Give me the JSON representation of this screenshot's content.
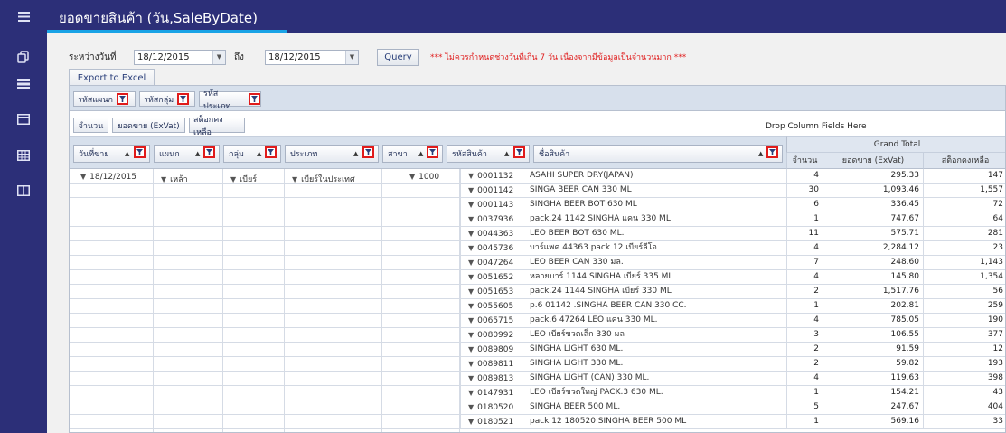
{
  "header": {
    "title": "ยอดขายสินค้า (วัน,SaleByDate)"
  },
  "sidebar": {
    "items": [
      {
        "icon": "hamburger-menu-icon"
      },
      {
        "icon": "copy-icon"
      },
      {
        "icon": "stack-icon"
      },
      {
        "icon": "card-icon"
      },
      {
        "icon": "grid-icon"
      },
      {
        "icon": "columns-icon"
      }
    ]
  },
  "filters": {
    "from_label": "ระหว่างวันที่",
    "from_value": "18/12/2015",
    "to_label": "ถึง",
    "to_value": "18/12/2015",
    "query_label": "Query",
    "warning": "*** ไม่ควรกำหนดช่วงวันที่เกิน 7 วัน เนื่องจากมีข้อมูลเป็นจำนวนมาก ***"
  },
  "export_label": "Export to Excel",
  "pivot": {
    "filter_fields": [
      "รหัสแผนก",
      "รหัสกลุ่ม",
      "รหัสประเภท"
    ],
    "data_fields": [
      "จำนวน",
      "ยอดขาย (ExVat)",
      "สต็อกคงเหลือ"
    ],
    "drop_column_text": "Drop Column Fields Here",
    "row_fields": [
      "วันที่ขาย",
      "แผนก",
      "กลุ่ม",
      "ประเภท",
      "สาขา",
      "รหัสสินค้า",
      "ชื่อสินค้า"
    ],
    "grand_total": "Grand Total",
    "measures": [
      "จำนวน",
      "ยอดขาย (ExVat)",
      "สต็อกคงเหลือ"
    ],
    "dims": {
      "date": "18/12/2015",
      "department": "เหล้า",
      "group": "เบียร์",
      "type": "เบียร์ในประเทศ",
      "branch": "1000"
    },
    "rows": [
      {
        "code": "0001132",
        "name": "ASAHI SUPER DRY(JAPAN)",
        "qty": "4",
        "sales": "295.33",
        "stock": "147"
      },
      {
        "code": "0001142",
        "name": "SINGA BEER CAN 330 ML",
        "qty": "30",
        "sales": "1,093.46",
        "stock": "1,557"
      },
      {
        "code": "0001143",
        "name": "SINGHA BEER BOT 630 ML",
        "qty": "6",
        "sales": "336.45",
        "stock": "72"
      },
      {
        "code": "0037936",
        "name": "pack.24 1142 SINGHA แคน 330 ML",
        "qty": "1",
        "sales": "747.67",
        "stock": "64"
      },
      {
        "code": "0044363",
        "name": "LEO BEER BOT 630 ML.",
        "qty": "11",
        "sales": "575.71",
        "stock": "281"
      },
      {
        "code": "0045736",
        "name": "บาร์แพค 44363 pack 12 เบียร์ลีโอ",
        "qty": "4",
        "sales": "2,284.12",
        "stock": "23"
      },
      {
        "code": "0047264",
        "name": "LEO BEER CAN 330 มล.",
        "qty": "7",
        "sales": "248.60",
        "stock": "1,143"
      },
      {
        "code": "0051652",
        "name": "หลายบาร์ 1144 SINGHA เบียร์ 335 ML",
        "qty": "4",
        "sales": "145.80",
        "stock": "1,354"
      },
      {
        "code": "0051653",
        "name": "pack.24 1144 SINGHA เบียร์ 330 ML",
        "qty": "2",
        "sales": "1,517.76",
        "stock": "56"
      },
      {
        "code": "0055605",
        "name": "p.6 01142 .SINGHA BEER CAN 330 CC.",
        "qty": "1",
        "sales": "202.81",
        "stock": "259"
      },
      {
        "code": "0065715",
        "name": "pack.6 47264 LEO แคน 330 ML.",
        "qty": "4",
        "sales": "785.05",
        "stock": "190"
      },
      {
        "code": "0080992",
        "name": "LEO เบียร์ขวดเล็ก 330 มล",
        "qty": "3",
        "sales": "106.55",
        "stock": "377"
      },
      {
        "code": "0089809",
        "name": "SINGHA LIGHT 630 ML.",
        "qty": "2",
        "sales": "91.59",
        "stock": "12"
      },
      {
        "code": "0089811",
        "name": "SINGHA LIGHT 330 ML.",
        "qty": "2",
        "sales": "59.82",
        "stock": "193"
      },
      {
        "code": "0089813",
        "name": "SINGHA LIGHT (CAN) 330 ML.",
        "qty": "4",
        "sales": "119.63",
        "stock": "398"
      },
      {
        "code": "0147931",
        "name": "LEO เบียร์ขวดใหญ่ PACK.3 630 ML.",
        "qty": "1",
        "sales": "154.21",
        "stock": "43"
      },
      {
        "code": "0180520",
        "name": "SINGHA BEER 500 ML.",
        "qty": "5",
        "sales": "247.67",
        "stock": "404"
      },
      {
        "code": "0180521",
        "name": "pack 12 180520 SINGHA BEER 500 ML",
        "qty": "1",
        "sales": "569.16",
        "stock": "33"
      }
    ]
  },
  "colors": {
    "sidebar": "#2c2f78",
    "accent": "#1aa3e6",
    "warning": "#e02020",
    "highlight": "#e01b1b"
  }
}
